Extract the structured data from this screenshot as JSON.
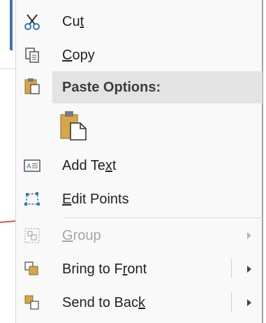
{
  "menu": {
    "items": [
      {
        "key": "cut",
        "pre": "Cu",
        "accel": "t",
        "post": "",
        "disabled": false
      },
      {
        "key": "copy",
        "pre": "",
        "accel": "C",
        "post": "opy",
        "disabled": false
      },
      {
        "key": "paste_header",
        "label": "Paste Options:"
      },
      {
        "key": "add_text",
        "pre": "Add Te",
        "accel": "x",
        "post": "t",
        "disabled": false
      },
      {
        "key": "edit_points",
        "pre": "",
        "accel": "E",
        "post": "dit Points",
        "disabled": false
      },
      {
        "key": "group",
        "pre": "",
        "accel": "G",
        "post": "roup",
        "disabled": true
      },
      {
        "key": "bring_front",
        "pre": "Bring to F",
        "accel": "r",
        "post": "ont",
        "disabled": false
      },
      {
        "key": "send_back",
        "pre": "Send to Bac",
        "accel": "k",
        "post": "",
        "disabled": false
      }
    ],
    "paste_icon": "paste-keep-formatting-icon"
  },
  "colors": {
    "accent": "#4472c4",
    "arrow": "#d9261c",
    "disabled": "#a6a6a6"
  }
}
